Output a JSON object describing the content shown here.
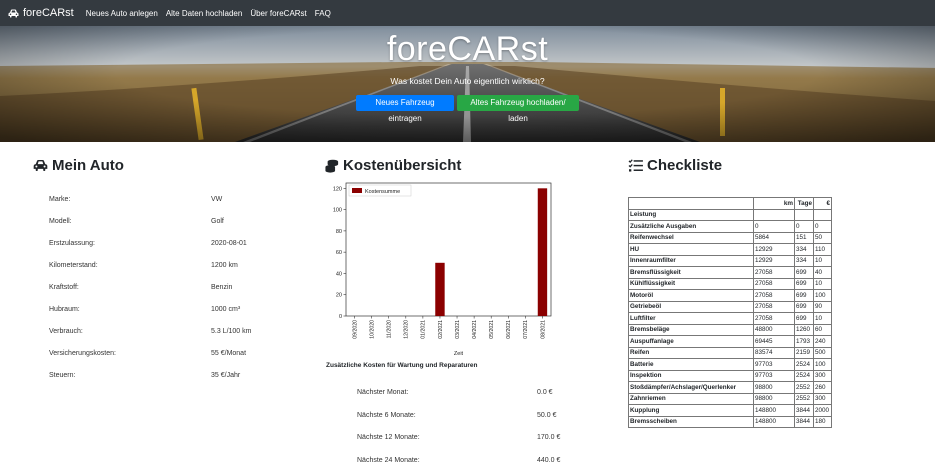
{
  "nav": {
    "brand": "foreCARst",
    "links": [
      "Neues Auto anlegen",
      "Alte Daten hochladen",
      "Über foreCARst",
      "FAQ"
    ]
  },
  "hero": {
    "title": "foreCARst",
    "subtitle": "Was kostet Dein Auto eigentlich wirklich?",
    "btn_new": "Neues Fahrzeug eintragen",
    "btn_load": "Altes Fahrzeug hochladen/ laden"
  },
  "auto": {
    "title": "Mein Auto",
    "rows": [
      {
        "label": "Marke:",
        "value": "VW"
      },
      {
        "label": "Modell:",
        "value": "Golf"
      },
      {
        "label": "Erstzulassung:",
        "value": "2020-08-01"
      },
      {
        "label": "Kilometerstand:",
        "value": "1200 km"
      },
      {
        "label": "Kraftstoff:",
        "value": "Benzin"
      },
      {
        "label": "Hubraum:",
        "value": "1000 cm³"
      },
      {
        "label": "Verbrauch:",
        "value": "5.3 L/100 km"
      },
      {
        "label": "Versicherungskosten:",
        "value": "55 €/Monat"
      },
      {
        "label": "Steuern:",
        "value": "35 €/Jahr"
      }
    ]
  },
  "kosten": {
    "title": "Kostenübersicht",
    "extra_title": "Zusätzliche Kosten für Wartung und Reparaturen",
    "rows": [
      {
        "label": "Nächster Monat:",
        "value": "0.0 €"
      },
      {
        "label": "Nächste 6 Monate:",
        "value": "50.0 €"
      },
      {
        "label": "Nächste 12 Monate:",
        "value": "170.0 €"
      },
      {
        "label": "Nächste 24 Monate:",
        "value": "440.0 €"
      }
    ]
  },
  "chart_data": {
    "type": "bar",
    "categories": [
      "09/2020",
      "10/2020",
      "11/2020",
      "12/2020",
      "01/2021",
      "02/2021",
      "03/2021",
      "04/2021",
      "05/2021",
      "06/2021",
      "07/2021",
      "08/2021"
    ],
    "series": [
      {
        "name": "Kostensumme",
        "values": [
          0,
          0,
          0,
          0,
          0,
          50,
          0,
          0,
          0,
          0,
          0,
          120
        ],
        "color": "#8b0000"
      }
    ],
    "xlabel": "Zeit",
    "ylabel": "",
    "ylim": [
      0,
      125
    ],
    "yticks": [
      0,
      20,
      40,
      60,
      80,
      100,
      120
    ],
    "legend": "top-left",
    "grid": false
  },
  "checkliste": {
    "title": "Checkliste",
    "headers": {
      "name": "",
      "km": "km",
      "tage": "Tage",
      "eur": "€"
    },
    "section": "Leistung",
    "rows": [
      {
        "name": "Zusätzliche Ausgaben",
        "km": "0",
        "tage": "0",
        "eur": "0"
      },
      {
        "name": "Reifenwechsel",
        "km": "5864",
        "tage": "151",
        "eur": "50"
      },
      {
        "name": "HU",
        "km": "12929",
        "tage": "334",
        "eur": "110"
      },
      {
        "name": "Innenraumfilter",
        "km": "12929",
        "tage": "334",
        "eur": "10"
      },
      {
        "name": "Bremsflüssigkeit",
        "km": "27058",
        "tage": "699",
        "eur": "40"
      },
      {
        "name": "Kühlflüssigkeit",
        "km": "27058",
        "tage": "699",
        "eur": "10"
      },
      {
        "name": "Motoröl",
        "km": "27058",
        "tage": "699",
        "eur": "100"
      },
      {
        "name": "Getriebeöl",
        "km": "27058",
        "tage": "699",
        "eur": "90"
      },
      {
        "name": "Luftfilter",
        "km": "27058",
        "tage": "699",
        "eur": "10"
      },
      {
        "name": "Bremsbeläge",
        "km": "48800",
        "tage": "1260",
        "eur": "60"
      },
      {
        "name": "Auspuffanlage",
        "km": "69445",
        "tage": "1793",
        "eur": "240"
      },
      {
        "name": "Reifen",
        "km": "83574",
        "tage": "2159",
        "eur": "500"
      },
      {
        "name": "Batterie",
        "km": "97703",
        "tage": "2524",
        "eur": "100"
      },
      {
        "name": "Inspektion",
        "km": "97703",
        "tage": "2524",
        "eur": "300"
      },
      {
        "name": "Stoßdämpfer/Achslager/Querlenker",
        "km": "98800",
        "tage": "2552",
        "eur": "260"
      },
      {
        "name": "Zahnriemen",
        "km": "98800",
        "tage": "2552",
        "eur": "300"
      },
      {
        "name": "Kupplung",
        "km": "148800",
        "tage": "3844",
        "eur": "2000"
      },
      {
        "name": "Bremsscheiben",
        "km": "148800",
        "tage": "3844",
        "eur": "180"
      }
    ]
  }
}
